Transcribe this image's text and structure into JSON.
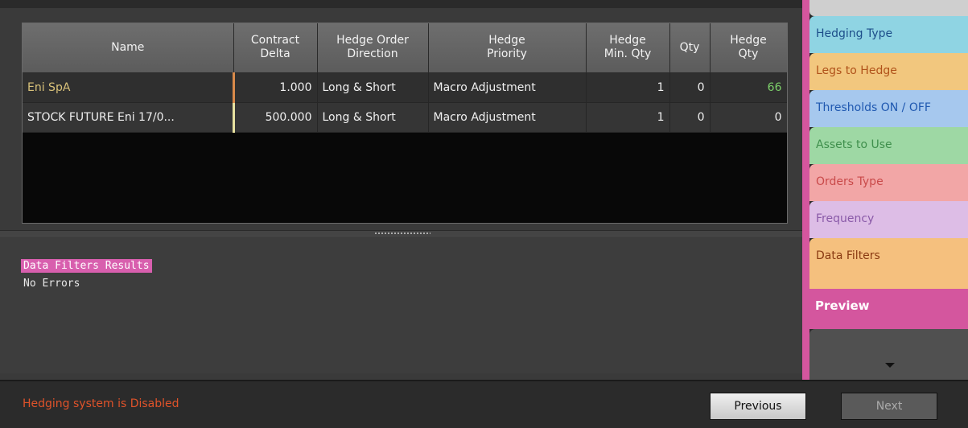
{
  "table": {
    "headers": [
      "Name",
      "Contract\nDelta",
      "Hedge Order\nDirection",
      "Hedge\nPriority",
      "Hedge\nMin. Qty",
      "Qty",
      "Hedge\nQty"
    ],
    "rows": [
      [
        "Eni SpA",
        "1.000",
        "Long & Short",
        "Macro Adjustment",
        "1",
        "0",
        "66"
      ],
      [
        "STOCK FUTURE Eni 17/0...",
        "500.000",
        "Long & Short",
        "Macro Adjustment",
        "1",
        "0",
        "0"
      ]
    ]
  },
  "log": {
    "title": "Data Filters Results",
    "line": "No Errors"
  },
  "footer": {
    "status": "Hedging system is Disabled",
    "previous": "Previous",
    "next": "Next"
  },
  "tabs": {
    "items": [
      {
        "label": "Hedging Type",
        "color": "#8fd4e3",
        "text": "#1d4e8a"
      },
      {
        "label": "Legs to Hedge",
        "color": "#f2c77e",
        "text": "#b0521a"
      },
      {
        "label": "Thresholds ON / OFF",
        "color": "#a6c8ee",
        "text": "#1f58b0"
      },
      {
        "label": "Assets to Use",
        "color": "#9ed8a4",
        "text": "#3f8f4c"
      },
      {
        "label": "Orders Type",
        "color": "#f2a6a6",
        "text": "#c94a4a"
      },
      {
        "label": "Frequency",
        "color": "#ddbde6",
        "text": "#8a5aa8"
      },
      {
        "label": "Data Filters",
        "color": "#f5c07e",
        "text": "#8a3a12"
      }
    ],
    "preview": "Preview"
  },
  "colors": {
    "accent": "#d4569e",
    "status": "#e0532a",
    "positive": "#7dd06a"
  }
}
